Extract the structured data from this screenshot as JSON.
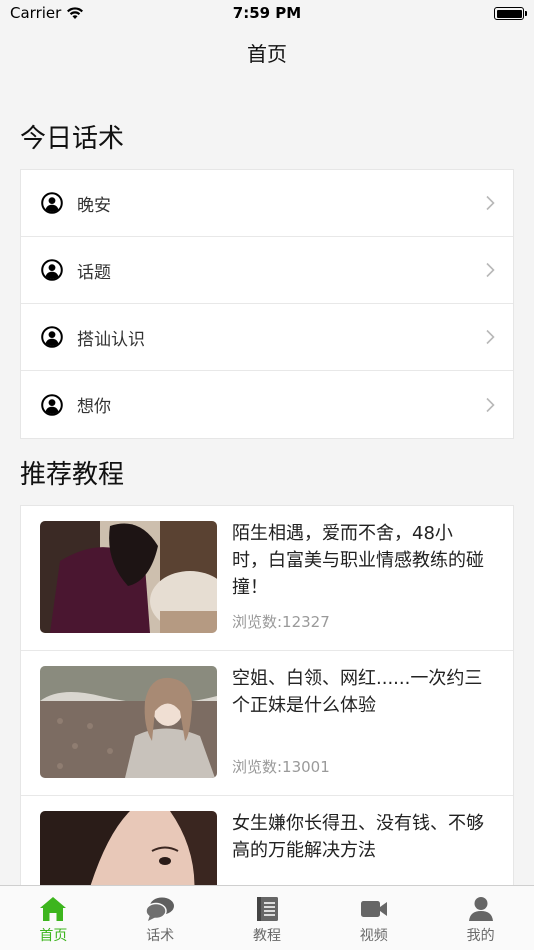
{
  "status_bar": {
    "carrier": "Carrier",
    "time": "7:59 PM"
  },
  "nav": {
    "title": "首页"
  },
  "today_talk": {
    "title": "今日话术",
    "items": [
      {
        "label": "晚安",
        "icon": "user-circle-icon"
      },
      {
        "label": "话题",
        "icon": "user-circle-icon"
      },
      {
        "label": "搭讪认识",
        "icon": "user-circle-icon"
      },
      {
        "label": "想你",
        "icon": "user-circle-icon"
      }
    ]
  },
  "tutorials": {
    "title": "推荐教程",
    "items": [
      {
        "title": "陌生相遇，爱而不舍，48小时，白富美与职业情感教练的碰撞！",
        "views": "浏览数:12327"
      },
      {
        "title": "空姐、白领、网红......一次约三个正妹是什么体验",
        "views": "浏览数:13001"
      },
      {
        "title": "女生嫌你长得丑、没有钱、不够高的万能解决方法",
        "views": ""
      }
    ]
  },
  "tab_bar": {
    "active_color": "#3db51e",
    "items": [
      {
        "label": "首页",
        "icon": "home-icon",
        "active": true
      },
      {
        "label": "话术",
        "icon": "chat-bubbles-icon",
        "active": false
      },
      {
        "label": "教程",
        "icon": "book-icon",
        "active": false
      },
      {
        "label": "视频",
        "icon": "video-camera-icon",
        "active": false
      },
      {
        "label": "我的",
        "icon": "person-icon",
        "active": false
      }
    ]
  }
}
